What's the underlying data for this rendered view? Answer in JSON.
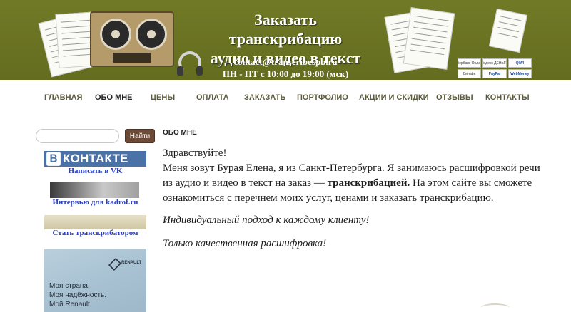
{
  "banner": {
    "title_line1": "Заказать транскрибацию",
    "title_line2": "аудио и видео в текст",
    "email": "contact@transcribespb.ru",
    "hours": "ПН - ПТ с 10:00 до 19:00 (мск)",
    "payment_logos": [
      "Сбербанк Онлайн",
      "Яндекс ДЕНЬГИ",
      "QIWI",
      "Билайн",
      "PayPal",
      "WebMoney"
    ]
  },
  "nav": {
    "items": [
      "ГЛАВНАЯ",
      "ОБО МНЕ",
      "ЦЕНЫ",
      "ОПЛАТА",
      "ЗАКАЗАТЬ",
      "ПОРТФОЛИО",
      "АКЦИИ И СКИДКИ",
      "ОТЗЫВЫ",
      "КОНТАКТЫ"
    ],
    "active": "ОБО МНЕ"
  },
  "sidebar": {
    "search_placeholder": "",
    "search_button": "Найти",
    "vk_logo_b": "B",
    "vk_logo_rest": "КОНТАКТЕ",
    "vk_link": "Написать в VK",
    "interview_link": "Интервью для kadrof.ru",
    "become_link": "Стать транскрибатором",
    "ad": {
      "brand": "RENAULT",
      "slogan_1": "Моя страна.",
      "slogan_2": "Моя надёжность.",
      "slogan_3": "Мой Renault"
    }
  },
  "main": {
    "page_title": "ОБО МНЕ",
    "greeting": "Здравствуйте!",
    "intro_before_bold": "Меня зовут Бурая Елена, я из Санкт-Петербурга. Я занимаюсь расшифровкой речи из аудио и видео в текст на заказ — ",
    "intro_bold": "транскрибацией.",
    "intro_after_bold": " На этом сайте вы сможете ознакомиться с перечнем моих услуг, ценами и заказать транскрибацию.",
    "p2": "Индивидуальный подход к каждому клиенту!",
    "p3": "Только качественная расшифровка!"
  }
}
